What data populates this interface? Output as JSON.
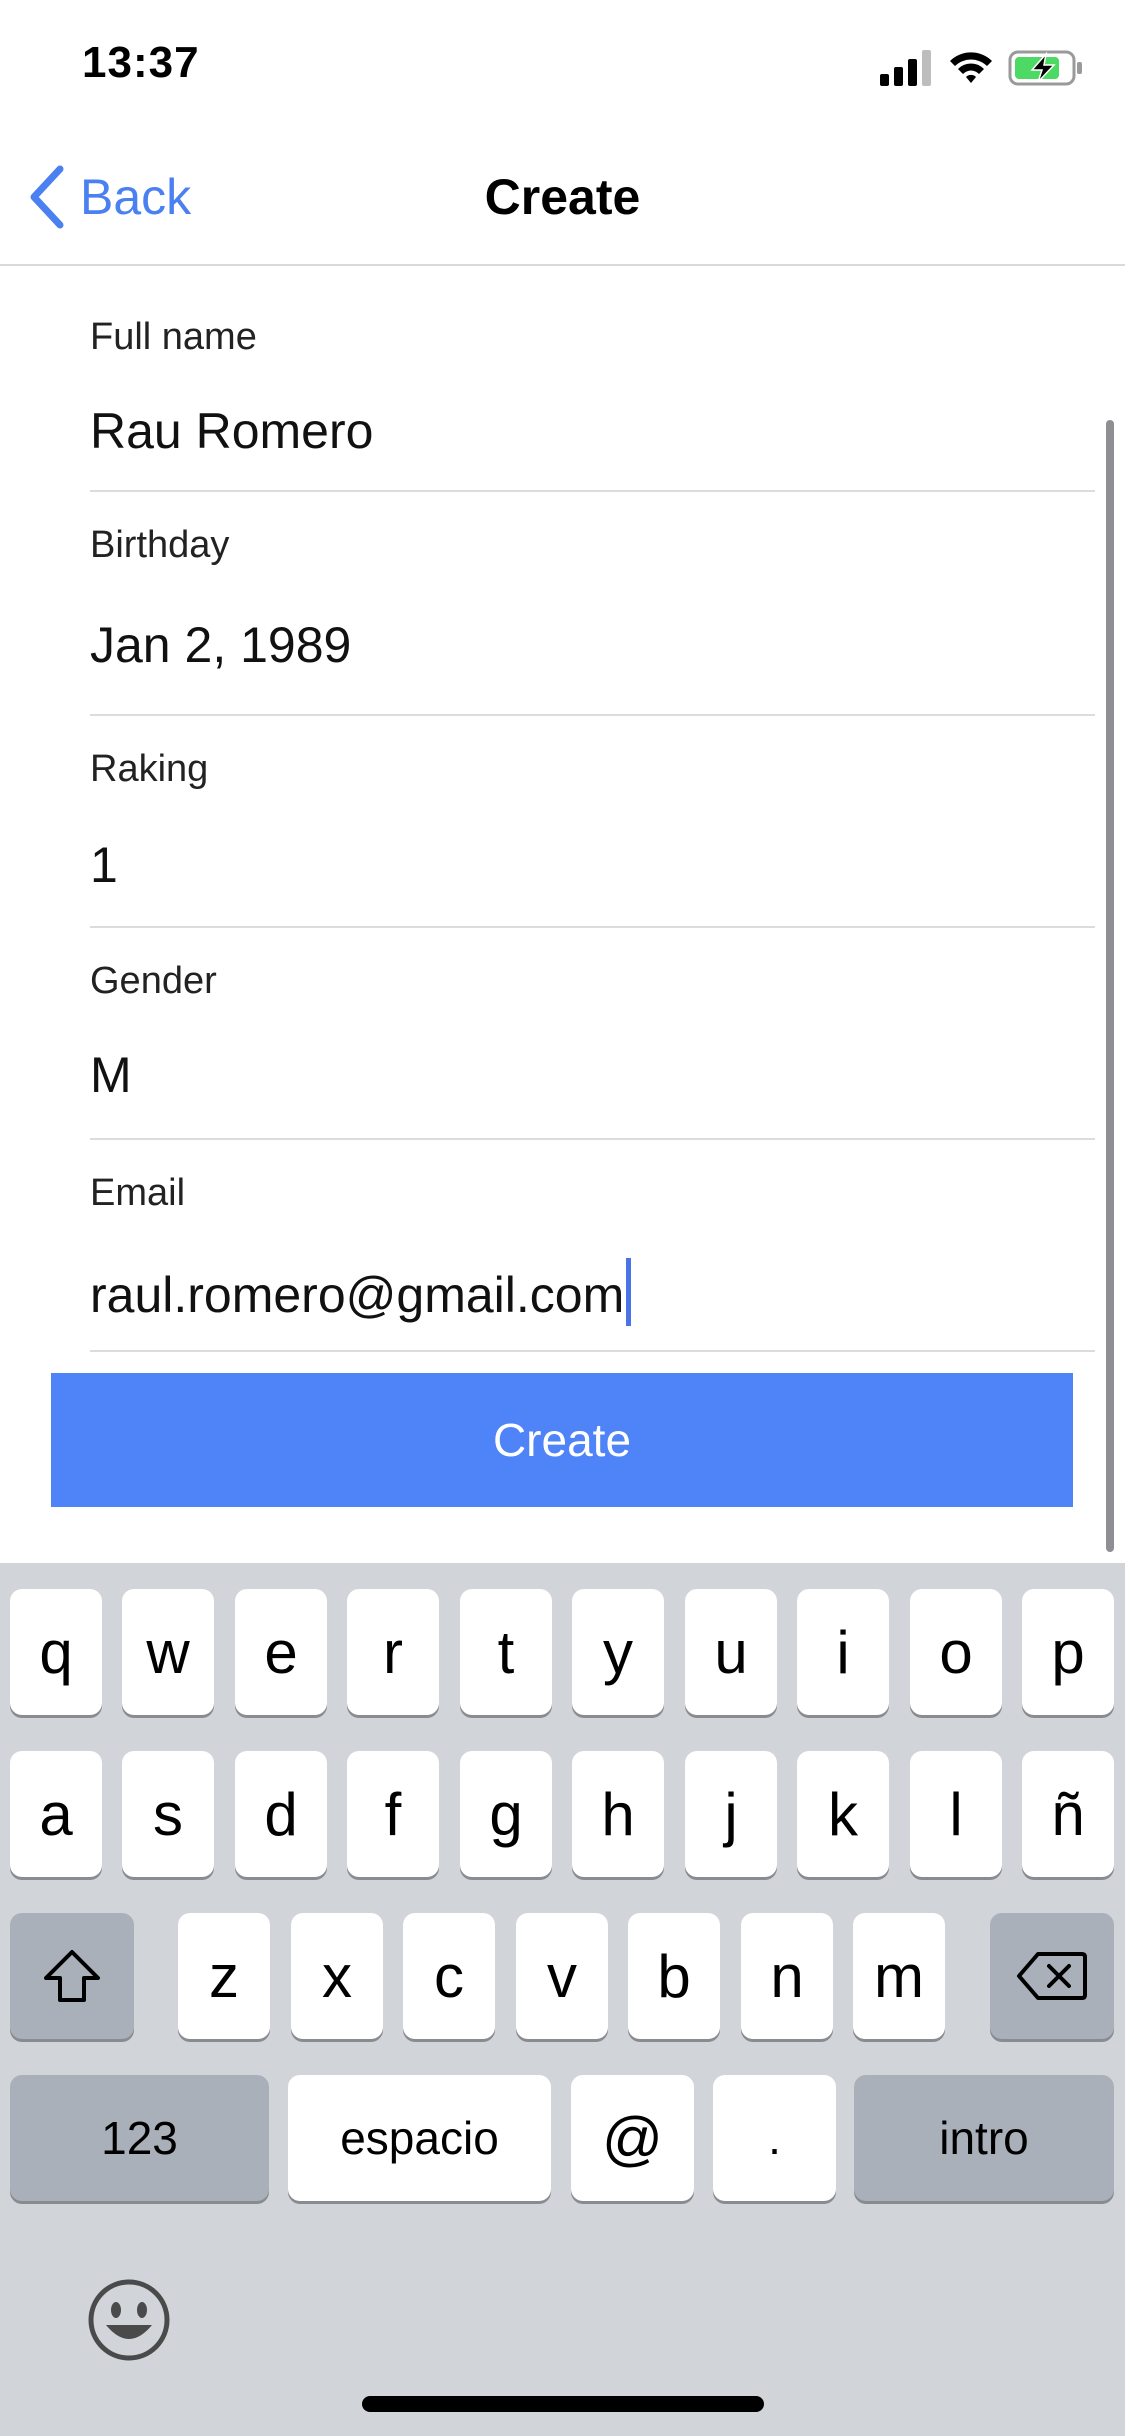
{
  "status_bar": {
    "time": "13:37"
  },
  "nav": {
    "back_label": "Back",
    "title": "Create"
  },
  "form": {
    "fields": [
      {
        "label": "Full name",
        "value": "Rau Romero"
      },
      {
        "label": "Birthday",
        "value": "Jan 2, 1989"
      },
      {
        "label": "Raking",
        "value": "1"
      },
      {
        "label": "Gender",
        "value": "M"
      },
      {
        "label": "Email",
        "value": "raul.romero@gmail.com"
      }
    ],
    "submit_label": "Create"
  },
  "keyboard": {
    "row1": [
      "q",
      "w",
      "e",
      "r",
      "t",
      "y",
      "u",
      "i",
      "o",
      "p"
    ],
    "row2": [
      "a",
      "s",
      "d",
      "f",
      "g",
      "h",
      "j",
      "k",
      "l",
      "ñ"
    ],
    "row3": [
      "z",
      "x",
      "c",
      "v",
      "b",
      "n",
      "m"
    ],
    "numbers_label": "123",
    "space_label": "espacio",
    "at_label": "@",
    "dot_label": ".",
    "return_label": "intro",
    "icons": {
      "shift": "shift-icon",
      "delete": "delete-icon",
      "emoji": "emoji-icon"
    }
  },
  "colors": {
    "accent": "#4a80f0",
    "button": "#4f83f8",
    "keyboard_bg": "#d1d4d9",
    "dark_key": "#aab0ba"
  }
}
